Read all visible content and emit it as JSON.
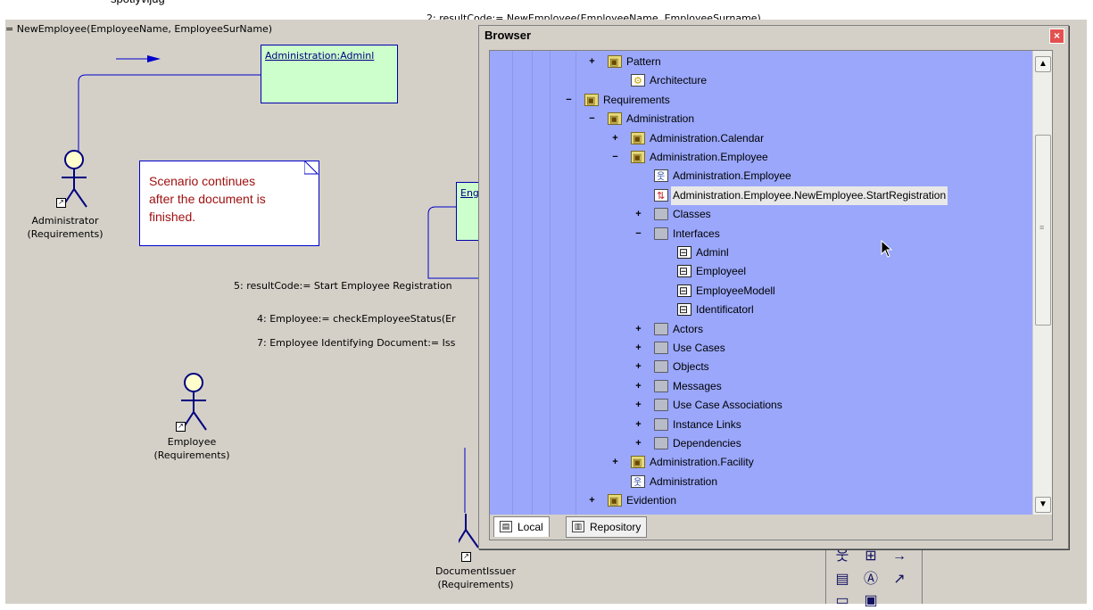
{
  "diagram": {
    "top_text": "2: resultCode:= NewEmployee(EmployeeName, EmployeeSurname)",
    "top_left_text": "spotlyvijug",
    "message_1": "= NewEmployee(EmployeeName, EmployeeSurName)",
    "object_admin": "Administration:Adminl",
    "object_emp": "Eng",
    "note_text": "Scenario continues\nafter the document is\nfinished.",
    "actor_admin": {
      "name": "Administrator",
      "pkg": "(Requirements)"
    },
    "actor_employee": {
      "name": "Employee",
      "pkg": "(Requirements)"
    },
    "actor_issuer": {
      "name": "DocumentIssuer",
      "pkg": "(Requirements)"
    },
    "message_5": "5: resultCode:= Start Employee Registration",
    "message_4": "4: Employee:= checkEmployeeStatus(Er",
    "message_7": "7: Employee Identifying Document:= Iss"
  },
  "browser": {
    "title": "Browser",
    "close_glyph": "×",
    "tree": [
      {
        "label": "Pattern",
        "icon": "package-icon",
        "expander": "+"
      },
      {
        "label": "Architecture",
        "icon": "diagram-icon",
        "expander": ""
      },
      {
        "label": "Requirements",
        "icon": "package-icon",
        "expander": "−"
      },
      {
        "label": "Administration",
        "icon": "package-icon",
        "expander": "−"
      },
      {
        "label": "Administration.Calendar",
        "icon": "package-icon",
        "expander": "+"
      },
      {
        "label": "Administration.Employee",
        "icon": "package-icon",
        "expander": "−"
      },
      {
        "label": "Administration.Employee",
        "icon": "use-case-diagram-icon",
        "expander": ""
      },
      {
        "label": "Administration.Employee.NewEmployee.StartRegistration",
        "icon": "sequence-diagram-icon",
        "expander": "",
        "selected": true
      },
      {
        "label": "Classes",
        "icon": "folder-icon",
        "expander": "+"
      },
      {
        "label": "Interfaces",
        "icon": "folder-icon",
        "expander": "−"
      },
      {
        "label": "Adminl",
        "icon": "interface-icon",
        "expander": ""
      },
      {
        "label": "Employeel",
        "icon": "interface-icon",
        "expander": ""
      },
      {
        "label": "EmployeeModell",
        "icon": "interface-icon",
        "expander": ""
      },
      {
        "label": "Identificatorl",
        "icon": "interface-icon",
        "expander": ""
      },
      {
        "label": "Actors",
        "icon": "folder-icon",
        "expander": "+"
      },
      {
        "label": "Use Cases",
        "icon": "folder-icon",
        "expander": "+"
      },
      {
        "label": "Objects",
        "icon": "folder-icon",
        "expander": "+"
      },
      {
        "label": "Messages",
        "icon": "folder-icon",
        "expander": "+"
      },
      {
        "label": "Use Case Associations",
        "icon": "folder-icon",
        "expander": "+"
      },
      {
        "label": "Instance Links",
        "icon": "folder-icon",
        "expander": "+"
      },
      {
        "label": "Dependencies",
        "icon": "folder-icon",
        "expander": "+"
      },
      {
        "label": "Administration.Facility",
        "icon": "package-icon",
        "expander": "+"
      },
      {
        "label": "Administration",
        "icon": "use-case-diagram-icon",
        "expander": ""
      },
      {
        "label": "Evidention",
        "icon": "package-icon",
        "expander": "+"
      }
    ],
    "scroll_up": "▲",
    "scroll_down": "▼",
    "tabs": [
      {
        "label": "Local"
      },
      {
        "label": "Repository"
      }
    ]
  },
  "palette": {
    "icons": [
      "actor-tool-icon",
      "class-tool-icon",
      "message-tool-icon",
      "note-tool-icon",
      "text-tool-icon",
      "link-tool-icon"
    ]
  }
}
